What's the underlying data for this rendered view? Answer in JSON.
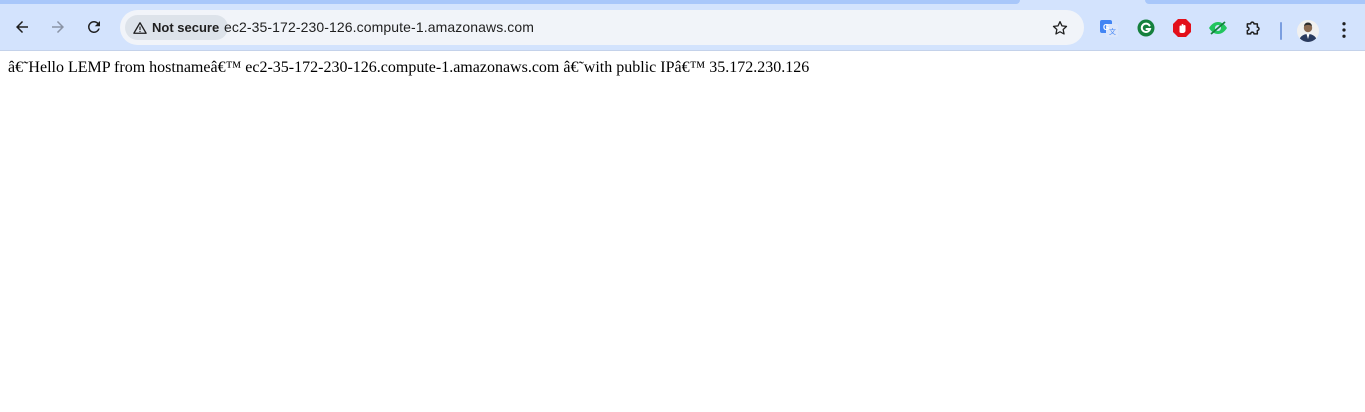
{
  "browser": {
    "security_label": "Not secure",
    "url": "ec2-35-172-230-126.compute-1.amazonaws.com",
    "icons": {
      "back": "back-arrow-icon",
      "forward": "forward-arrow-icon",
      "reload": "reload-icon",
      "warning": "warning-triangle-icon",
      "bookmark": "star-icon",
      "extensions": [
        "google-translate-icon",
        "grammarly-icon",
        "adblock-icon",
        "eye-extension-icon",
        "puzzle-extensions-icon"
      ],
      "menu": "three-dot-menu-icon"
    },
    "colors": {
      "toolbar": "#d3e3fd",
      "omnibox": "#f1f4f9",
      "chip": "#dde3ea"
    }
  },
  "page": {
    "text": "â€˜Hello LEMP from hostnameâ€™ ec2-35-172-230-126.compute-1.amazonaws.com â€˜with public IPâ€™ 35.172.230.126"
  }
}
